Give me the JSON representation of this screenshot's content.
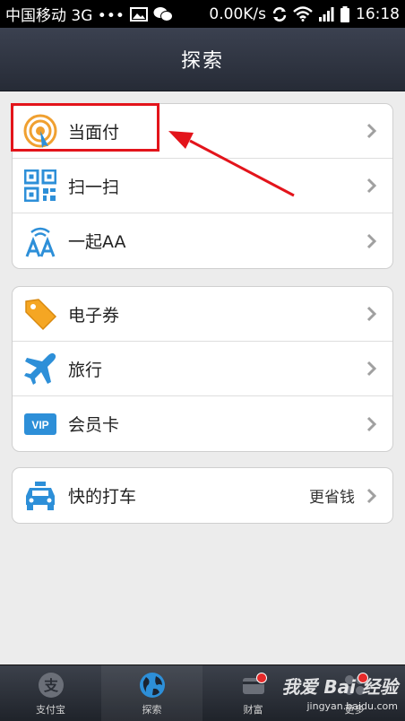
{
  "status_bar": {
    "carrier": "中国移动 3G •••",
    "speed": "0.00K/s",
    "time": "16:18"
  },
  "header": {
    "title": "探索"
  },
  "groups": [
    {
      "items": [
        {
          "label": "当面付",
          "icon": "face-pay-icon"
        },
        {
          "label": "扫一扫",
          "icon": "qr-scan-icon"
        },
        {
          "label": "一起AA",
          "icon": "aa-split-icon"
        }
      ]
    },
    {
      "items": [
        {
          "label": "电子券",
          "icon": "coupon-tag-icon"
        },
        {
          "label": "旅行",
          "icon": "airplane-icon"
        },
        {
          "label": "会员卡",
          "icon": "vip-card-icon",
          "icon_text": "VIP"
        }
      ]
    },
    {
      "items": [
        {
          "label": "快的打车",
          "extra": "更省钱",
          "icon": "taxi-icon"
        }
      ]
    }
  ],
  "tabbar": {
    "tabs": [
      {
        "label": "支付宝",
        "icon": "alipay-icon",
        "icon_text": "支"
      },
      {
        "label": "探索",
        "icon": "globe-icon",
        "active": true
      },
      {
        "label": "财富",
        "icon": "wealth-icon",
        "badge": true
      },
      {
        "label": "更多",
        "icon": "more-icon",
        "badge": true
      }
    ]
  },
  "watermark": {
    "text": "我爱 Bai 经验",
    "url": "jingyan.baidu.com"
  },
  "colors": {
    "highlight": "#e3141b",
    "header_bg": "#2f3440",
    "page_bg": "#ececec"
  }
}
